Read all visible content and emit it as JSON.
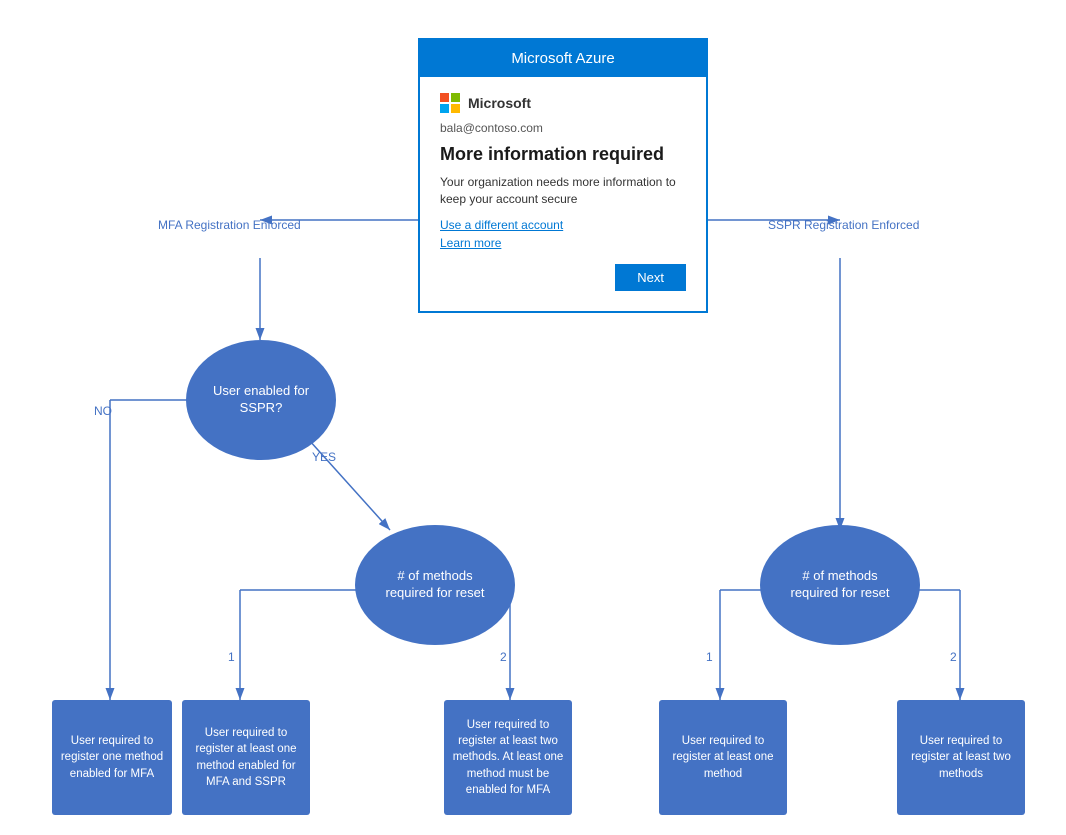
{
  "dialog": {
    "header": "Microsoft Azure",
    "company": "Microsoft",
    "email": "bala@contoso.com",
    "title": "More information required",
    "description": "Your organization needs more information to keep your account secure",
    "link1": "Use a different account",
    "link2": "Learn more",
    "next_button": "Next"
  },
  "nodes": {
    "sspr_question": "User enabled for\nSSPR?",
    "methods_left": "# of methods\nrequired for reset",
    "methods_right": "# of methods\nrequired for reset",
    "result1": "User required to\nregister one method\nenabled for MFA",
    "result2": "User required to\nregister at least one\nmethod enabled for\nMFA and SSPR",
    "result3": "User required to\nregister at least two\nmethods. At least\none method must\nbe enabled for MFA",
    "result4": "User required to\nregister at least one\nmethod",
    "result5": "User required to\nregister at least two\nmethods"
  },
  "labels": {
    "mfa_enforced": "MFA Registration Enforced",
    "sspr_enforced": "SSPR Registration Enforced",
    "no": "NO",
    "yes": "YES",
    "one_left": "1",
    "two_left": "2",
    "one_right": "1",
    "two_right": "2"
  }
}
